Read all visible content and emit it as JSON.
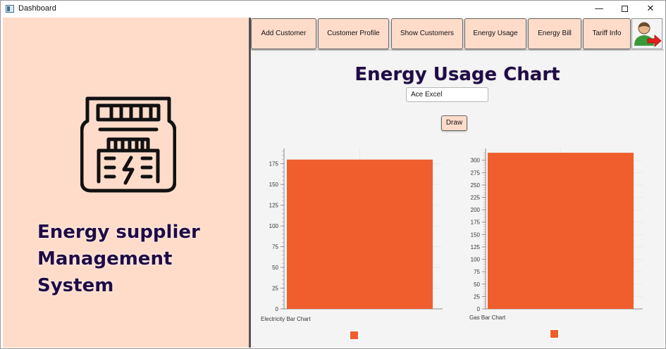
{
  "window": {
    "title": "Dashboard",
    "minimize_glyph": "—",
    "close_glyph": "✕"
  },
  "sidebar": {
    "brand_lines": [
      "Energy supplier",
      "Management",
      "System"
    ],
    "icon": "electric-meter-icon"
  },
  "navbar": {
    "buttons": [
      {
        "label": "Add Customer"
      },
      {
        "label": "Customer Profile"
      },
      {
        "label": "Show Customers"
      },
      {
        "label": "Energy Usage"
      },
      {
        "label": "Energy Bill"
      },
      {
        "label": "Tariff Info"
      }
    ],
    "logout_icon": "user-logout-icon"
  },
  "main": {
    "heading": "Energy Usage Chart",
    "customer_value": "Ace Excel",
    "draw_label": "Draw"
  },
  "colors": {
    "bar": "#ef5e2c",
    "panel": "#ffdcca",
    "brand_text": "#1f0b45"
  },
  "chart_data": [
    {
      "type": "bar",
      "caption": "Electricity Bar Chart",
      "categories": [
        ""
      ],
      "values": [
        180
      ],
      "ylim": [
        0,
        190
      ],
      "yticks": [
        0,
        25,
        50,
        75,
        100,
        125,
        150,
        175
      ],
      "grid": true,
      "legend": "bottom-center"
    },
    {
      "type": "bar",
      "caption": "Gas Bar Chart",
      "categories": [
        ""
      ],
      "values": [
        315
      ],
      "ylim": [
        0,
        318
      ],
      "yticks": [
        0,
        25,
        50,
        75,
        100,
        125,
        150,
        175,
        200,
        225,
        250,
        275,
        300
      ],
      "grid": true,
      "legend": "bottom-center"
    }
  ]
}
